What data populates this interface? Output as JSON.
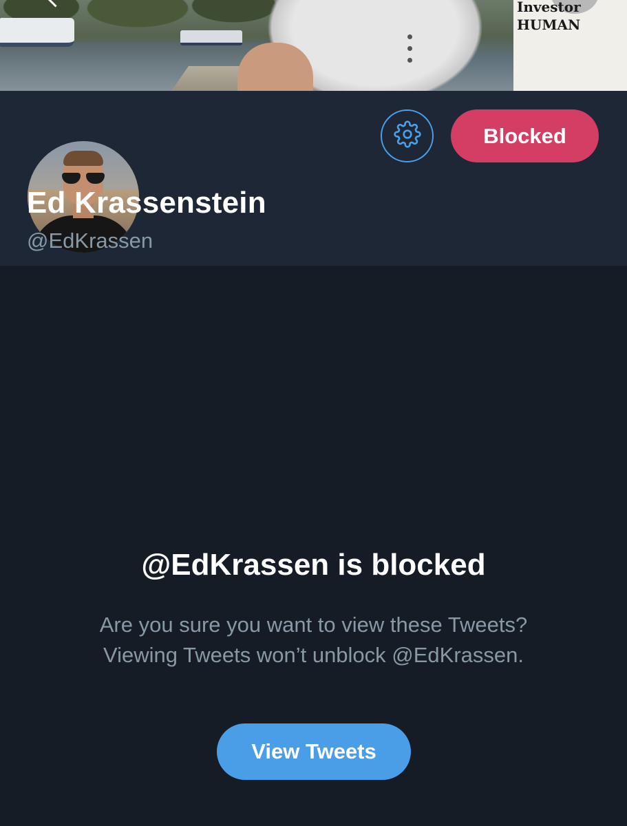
{
  "banner": {
    "poster_text": "Investor\nHUMAN",
    "icon": "back-chevron-icon"
  },
  "profile": {
    "display_name": "Ed Krassenstein",
    "handle": "@EdKrassen",
    "settings_icon": "gear-icon",
    "blocked_label": "Blocked"
  },
  "notice": {
    "title": "@EdKrassen is blocked",
    "body": "Are you sure you want to view these Tweets? Viewing Tweets won’t unblock @EdKrassen.",
    "button_label": "View Tweets"
  },
  "colors": {
    "background": "#161c26",
    "header_background": "#1d2735",
    "blocked_red": "#d43e64",
    "accent_blue": "#4a9ee8",
    "muted_text": "#8899a6"
  }
}
